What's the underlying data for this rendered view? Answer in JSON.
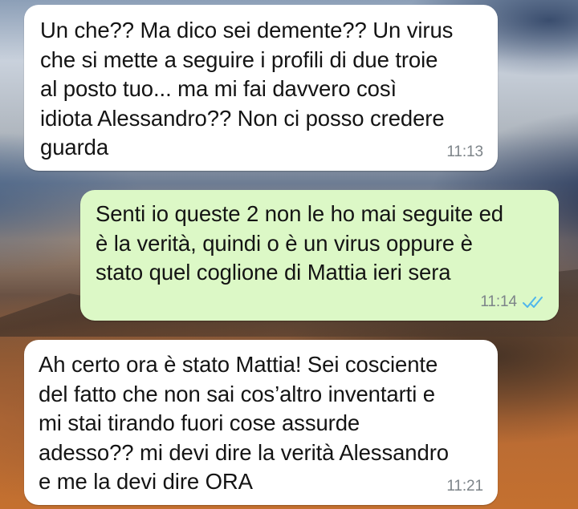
{
  "chat": {
    "messages": [
      {
        "direction": "incoming",
        "text": "Un che?? Ma dico sei demente?? Un virus\nche si mette a seguire i profili di due troie\nal posto tuo... ma mi fai davvero così\nidiota Alessandro?? Non ci posso credere\nguarda",
        "time": "11:13"
      },
      {
        "direction": "outgoing",
        "text": "Senti io queste 2 non le ho mai seguite ed\nè la verità, quindi o è un virus oppure è\nstato quel coglione di Mattia ieri sera",
        "time": "11:14",
        "status_icon": "double-check-read-icon"
      },
      {
        "direction": "incoming",
        "text": "Ah certo ora è stato Mattia! Sei cosciente\ndel fatto che non sai cos’altro inventarti e\nmi stai tirando fuori cose assurde\nadesso?? mi devi dire la verità Alessandro\ne me la devi dire ORA",
        "time": "11:21"
      }
    ]
  },
  "colors": {
    "incoming_bubble": "#ffffff",
    "outgoing_bubble": "#dcf8c6",
    "timestamp": "#7d8489",
    "read_ticks": "#4fb6ec"
  }
}
